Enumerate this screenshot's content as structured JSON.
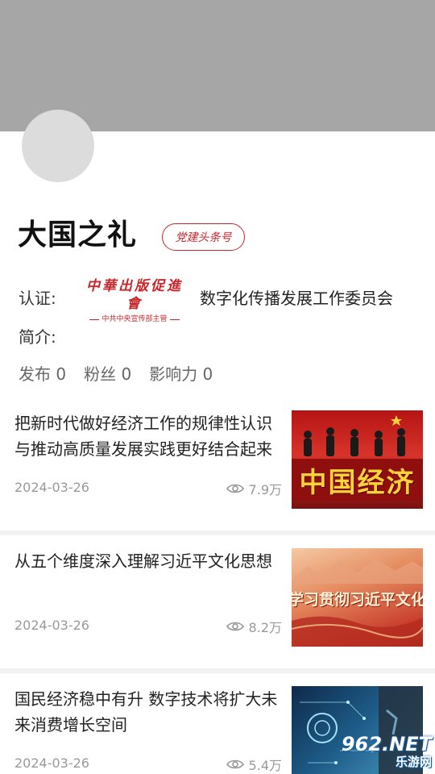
{
  "profile": {
    "name": "大国之礼",
    "badge": "党建头条号",
    "cert_label": "认证:",
    "cert_logo_text": "中華出版促進會",
    "cert_logo_sub": "中共中央宣传部主管",
    "cert_org": "数字化传播发展工作委员会",
    "intro_label": "简介:",
    "stats": {
      "publish": "发布 0",
      "fans": "粉丝 0",
      "influence": "影响力 0"
    }
  },
  "articles": [
    {
      "title": "把新时代做好经济工作的规律性认识与推动高质量发展实践更好结合起来",
      "date": "2024-03-26",
      "views": "7.9万",
      "thumb_text": "中国经济"
    },
    {
      "title": "从五个维度深入理解习近平文化思想",
      "date": "2024-03-26",
      "views": "8.2万",
      "thumb_text": "学习贯彻习近平文化"
    },
    {
      "title": "国民经济稳中有升 数字技术将扩大未来消费增长空间",
      "date": "2024-03-26",
      "views": "5.4万",
      "thumb_text": ""
    }
  ],
  "watermark": {
    "number": "962.NET",
    "site": "乐游网"
  },
  "colors": {
    "accent_red": "#c9262b",
    "cover_gray": "#a6a6a6"
  }
}
